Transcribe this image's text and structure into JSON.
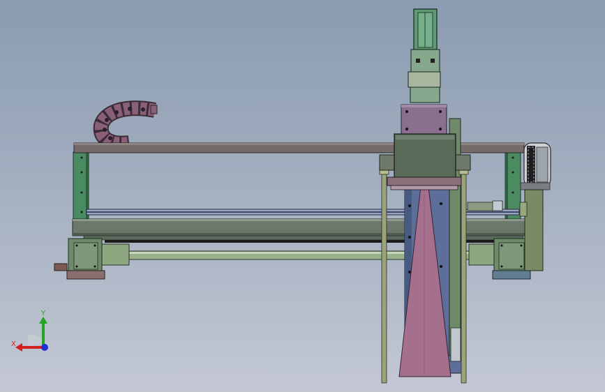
{
  "viewport": {
    "background_top": "#8b9bb0",
    "background_bottom": "#c3c8d3"
  },
  "model": {
    "parts": [
      "top-rail-beam",
      "left-upright",
      "right-upright",
      "cable-chain",
      "right-cable-chain",
      "lower-frame-beam",
      "linear-guide",
      "drive-shaft",
      "left-motor-housing",
      "right-motor-housing",
      "vertical-motor",
      "carriage-block",
      "guide-rods",
      "tapered-arm",
      "vertical-slide-plate"
    ],
    "colors": {
      "beam": "#6f6c68",
      "frame_green": "#4b8b61",
      "housing_green": "#6f8a6a",
      "shaft_green": "#9ab28c",
      "carriage_purple": "#8a6f8e",
      "arm_pink": "#a56f8e",
      "slide_blue": "#5b6f9a",
      "cable_chain": "#8a5f7a"
    }
  },
  "triad": {
    "y_label": "Y",
    "x_label": "X",
    "y_color": "#22a622",
    "x_color": "#d42020",
    "z_color": "#2030d0"
  }
}
